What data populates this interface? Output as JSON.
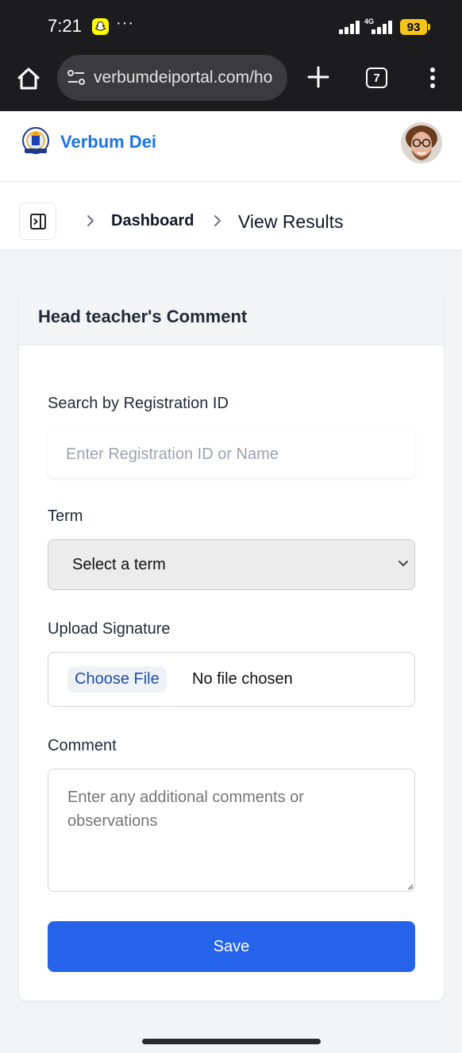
{
  "status_bar": {
    "time": "7:21",
    "dots": "···",
    "network": "4G",
    "battery": "93"
  },
  "browser": {
    "url": "verbumdeiportal.com/ho",
    "tab_count": "7"
  },
  "header": {
    "brand": "Verbum Dei"
  },
  "breadcrumb": {
    "items": [
      "Dashboard",
      "View Results"
    ]
  },
  "card": {
    "title": "Head teacher's Comment",
    "search": {
      "label": "Search by Registration ID",
      "placeholder": "Enter Registration ID or Name",
      "value": ""
    },
    "term": {
      "label": "Term",
      "selected": "Select a term"
    },
    "signature": {
      "label": "Upload Signature",
      "button": "Choose File",
      "status": "No file chosen"
    },
    "comment": {
      "label": "Comment",
      "placeholder": "Enter any additional comments or observations"
    },
    "save_label": "Save"
  },
  "colors": {
    "brand": "#1a73e8",
    "primary_button": "#2563eb",
    "status_bar_bg": "#1c1c1e",
    "battery": "#f5c518"
  }
}
